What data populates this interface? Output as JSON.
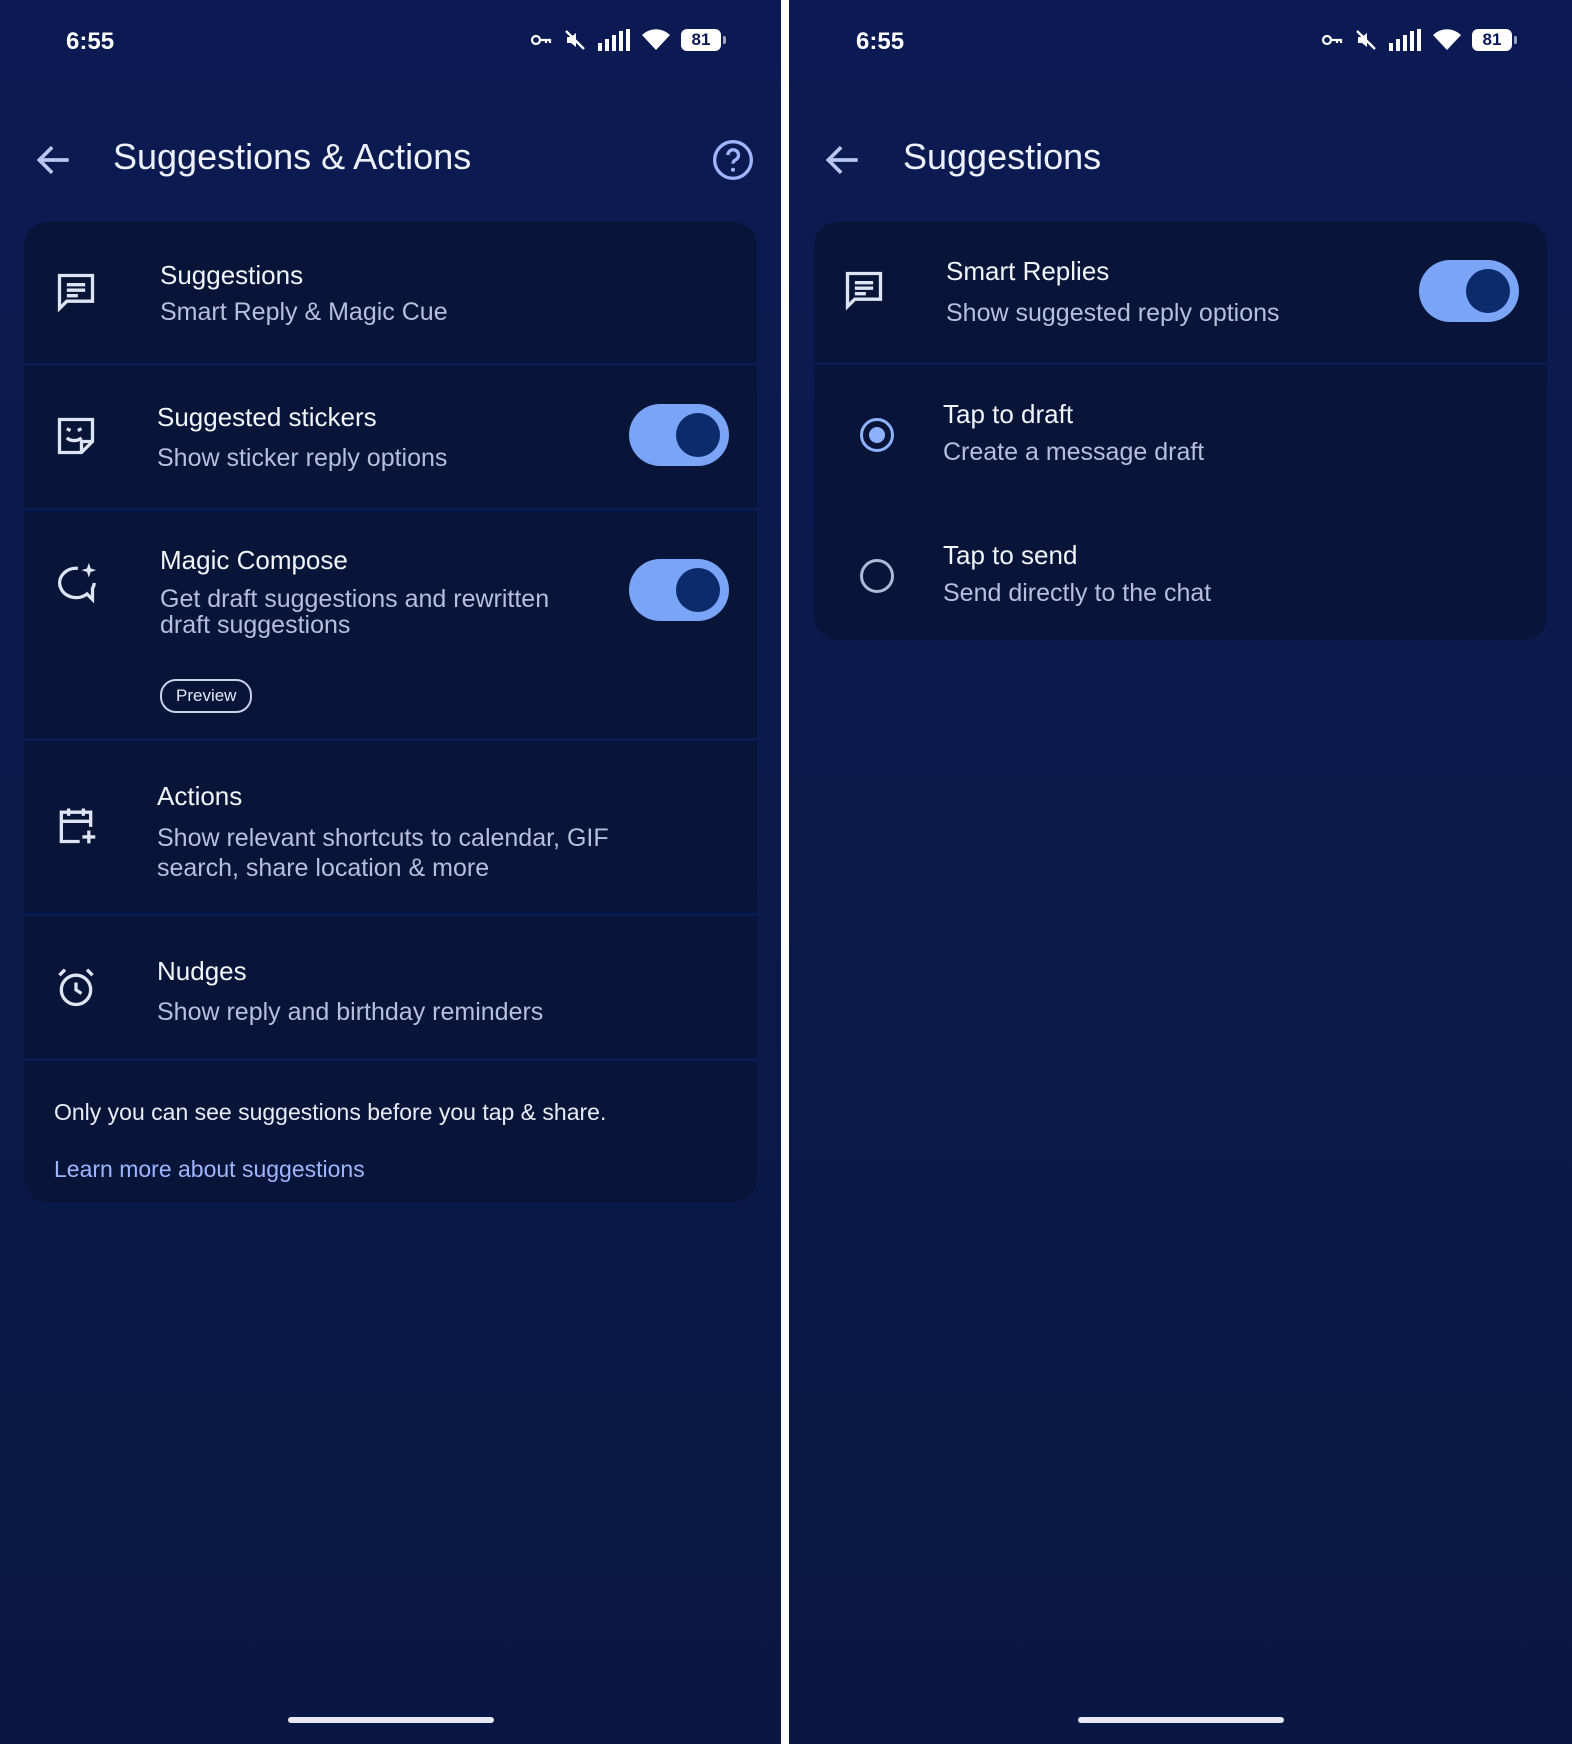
{
  "left": {
    "status": {
      "time": "6:55",
      "battery": "81"
    },
    "title": "Suggestions & Actions",
    "rows": [
      {
        "title": "Suggestions",
        "subtitle": "Smart Reply & Magic Cue"
      },
      {
        "title": "Suggested stickers",
        "subtitle": "Show sticker reply options",
        "toggle_on": true
      },
      {
        "title": "Magic Compose",
        "subtitle_line1": "Get draft suggestions and rewritten",
        "subtitle_line2": "draft suggestions",
        "chip": "Preview",
        "toggle_on": true
      },
      {
        "title": "Actions",
        "subtitle_line1": "Show relevant shortcuts to calendar, GIF",
        "subtitle_line2": "search, share location & more"
      },
      {
        "title": "Nudges",
        "subtitle": "Show reply and birthday reminders"
      }
    ],
    "info": {
      "text": "Only you can see suggestions before you tap & share.",
      "link": "Learn more about suggestions"
    }
  },
  "right": {
    "status": {
      "time": "6:55",
      "battery": "81"
    },
    "title": "Suggestions",
    "smart_replies": {
      "title": "Smart Replies",
      "subtitle": "Show suggested reply options",
      "toggle_on": true
    },
    "options": [
      {
        "title": "Tap to draft",
        "subtitle": "Create a message draft",
        "selected": true
      },
      {
        "title": "Tap to send",
        "subtitle": "Send directly to the chat",
        "selected": false
      }
    ]
  },
  "colors": {
    "background": "#0b1a52",
    "card": "#081538",
    "accent": "#7aa5f7",
    "link": "#9fb6ff"
  }
}
